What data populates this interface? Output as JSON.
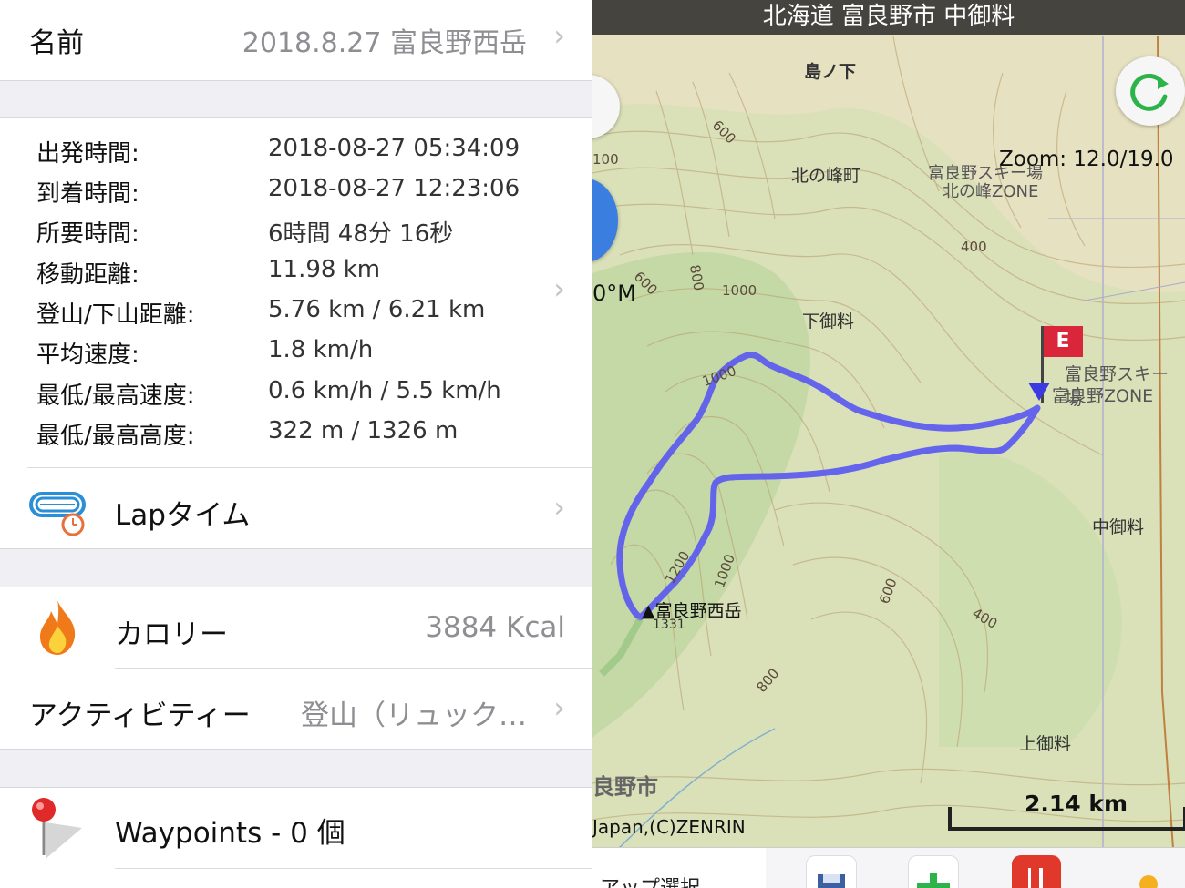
{
  "detail": {
    "name_label": "名前",
    "name_value": "2018.8.27 富良野西岳",
    "stats": [
      {
        "label": "出発時間:",
        "value": "2018-08-27 05:34:09"
      },
      {
        "label": "到着時間:",
        "value": "2018-08-27 12:23:06"
      },
      {
        "label": "所要時間:",
        "value": "6時間 48分 16秒"
      },
      {
        "label": "移動距離:",
        "value": "11.98 km"
      },
      {
        "label": "登山/下山距離:",
        "value": "5.76 km / 6.21 km"
      },
      {
        "label": "平均速度:",
        "value": "1.8 km/h"
      },
      {
        "label": "最低/最高速度:",
        "value": "0.6 km/h / 5.5 km/h"
      },
      {
        "label": "最低/最高高度:",
        "value": "322 m / 1326 m"
      }
    ],
    "lap_label": "Lapタイム",
    "calorie_label": "カロリー",
    "calorie_value": "3884 Kcal",
    "activity_label": "アクティビティー",
    "activity_value": "登山（リュック…",
    "waypoints_label": "Waypoints - 0 個",
    "chevron": "›"
  },
  "map": {
    "title": "北海道 富良野市 中御料",
    "zoom": "Zoom: 12.0/19.0",
    "scale": "2.14 km",
    "copyright": "Japan,(C)ZENRIN",
    "partial_elev": "0°M",
    "place_labels": {
      "shimanoshita": "島ノ下",
      "kitanomine": "北の峰町",
      "ski_kitanomine": "富良野スキー場",
      "ski_kitanomine_zone": "北の峰ZONE",
      "shimogoryo": "下御料",
      "ski_furano": "富良野スキー場",
      "ski_furano_zone": "富良野ZONE",
      "nakagoryo": "中御料",
      "kamigoryo": "上御料",
      "peak": "▲富良野西岳",
      "peak_elev": "1331",
      "city": "良野市"
    },
    "contour_labels": [
      "600",
      "400",
      "800",
      "600",
      "1000",
      "1000",
      "1200",
      "1000",
      "600",
      "400",
      "800",
      "100"
    ],
    "end_marker": "E",
    "toolbar_label": "アップ選択",
    "colors": {
      "track": "#5a5af0",
      "map_bg": "#e8e3c4",
      "flag": "#d9263a"
    }
  }
}
